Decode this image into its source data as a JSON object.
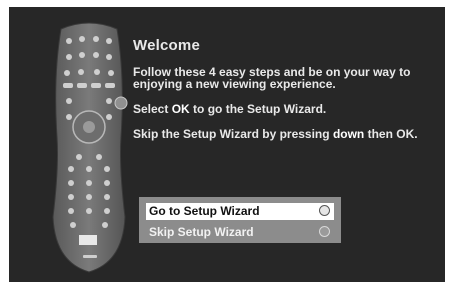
{
  "dialog": {
    "title": "Welcome",
    "paragraph1": "Follow these 4 easy steps and be on your way to enjoying a new viewing experience.",
    "paragraph2_pre": "Select ",
    "paragraph2_key": "OK",
    "paragraph2_post": " to go the Setup Wizard.",
    "paragraph3_pre": "Skip the Setup Wizard by pressing ",
    "paragraph3_key": "down",
    "paragraph3_post": " then OK."
  },
  "menu": {
    "items": [
      {
        "label": "Go to Setup Wizard",
        "selected": true
      },
      {
        "label": "Skip Setup Wizard",
        "selected": false
      }
    ]
  },
  "graphics": {
    "remote_icon": "remote-control-illustration"
  },
  "colors": {
    "background": "#272727",
    "text": "#e9e9e9",
    "menu_panel": "#8c8c8c",
    "selected_item": "#ffffff"
  }
}
